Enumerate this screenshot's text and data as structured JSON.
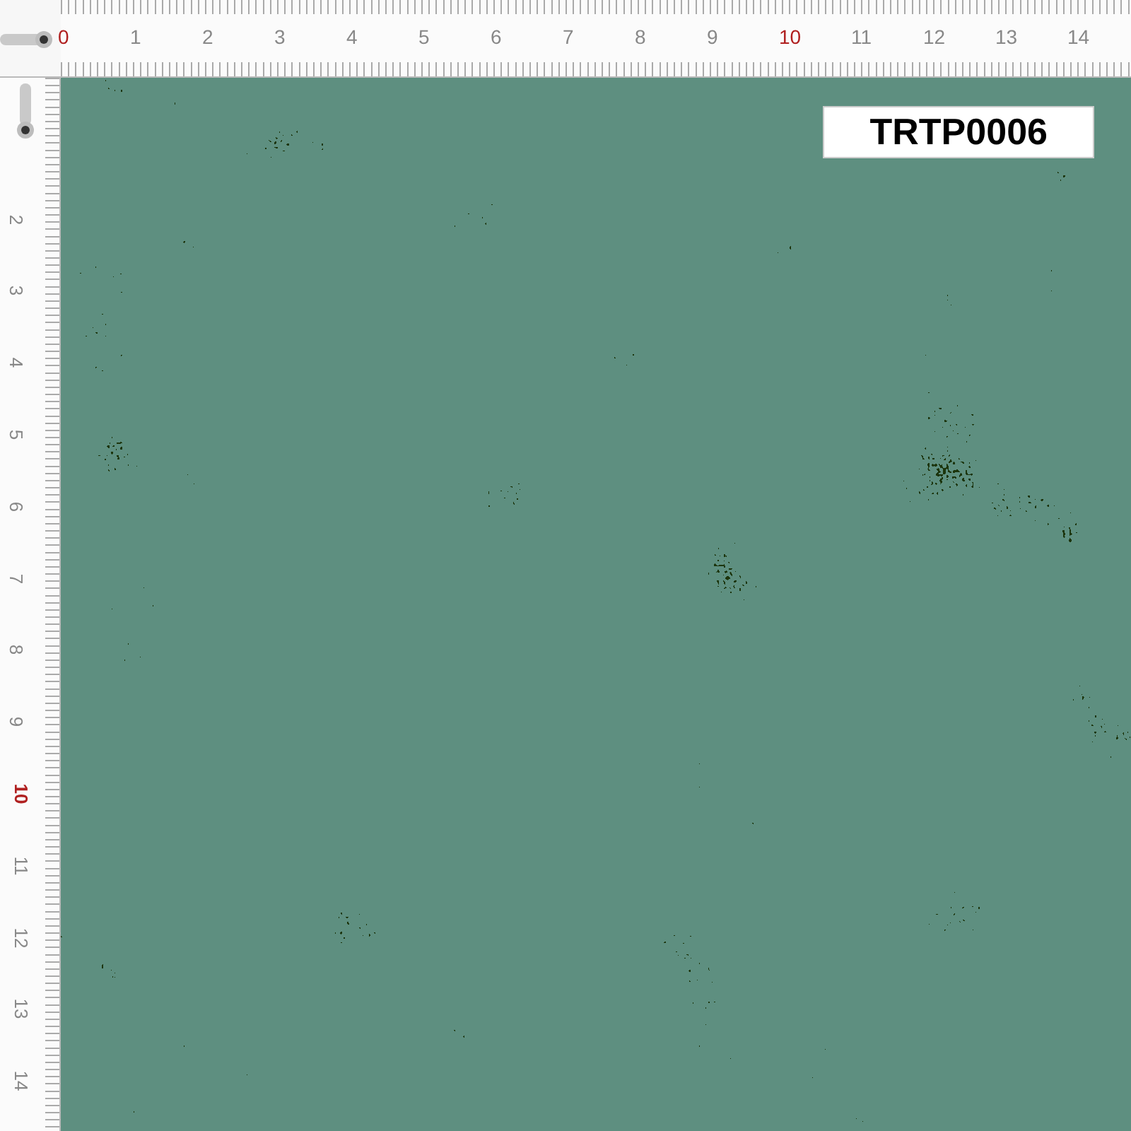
{
  "rulers": {
    "top": {
      "labels": [
        {
          "text": "0",
          "highlighted": true
        },
        {
          "text": "1",
          "highlighted": false
        },
        {
          "text": "2",
          "highlighted": false
        },
        {
          "text": "3",
          "highlighted": false
        },
        {
          "text": "4",
          "highlighted": false
        },
        {
          "text": "5",
          "highlighted": false
        },
        {
          "text": "6",
          "highlighted": false
        },
        {
          "text": "7",
          "highlighted": false
        },
        {
          "text": "8",
          "highlighted": false
        },
        {
          "text": "9",
          "highlighted": false
        },
        {
          "text": "10",
          "highlighted": true
        },
        {
          "text": "11",
          "highlighted": false
        },
        {
          "text": "12",
          "highlighted": false
        },
        {
          "text": "13",
          "highlighted": false
        },
        {
          "text": "14",
          "highlighted": false
        }
      ]
    },
    "left": {
      "labels": [
        {
          "text": "2",
          "highlighted": false
        },
        {
          "text": "3",
          "highlighted": false
        },
        {
          "text": "4",
          "highlighted": false
        },
        {
          "text": "5",
          "highlighted": false
        },
        {
          "text": "6",
          "highlighted": false
        },
        {
          "text": "7",
          "highlighted": false
        },
        {
          "text": "8",
          "highlighted": false
        },
        {
          "text": "9",
          "highlighted": false
        },
        {
          "text": "10",
          "highlighted": true
        },
        {
          "text": "11",
          "highlighted": false
        },
        {
          "text": "12",
          "highlighted": false
        },
        {
          "text": "13",
          "highlighted": false
        },
        {
          "text": "14",
          "highlighted": false
        }
      ]
    }
  },
  "pattern_code": "TRTP0006"
}
